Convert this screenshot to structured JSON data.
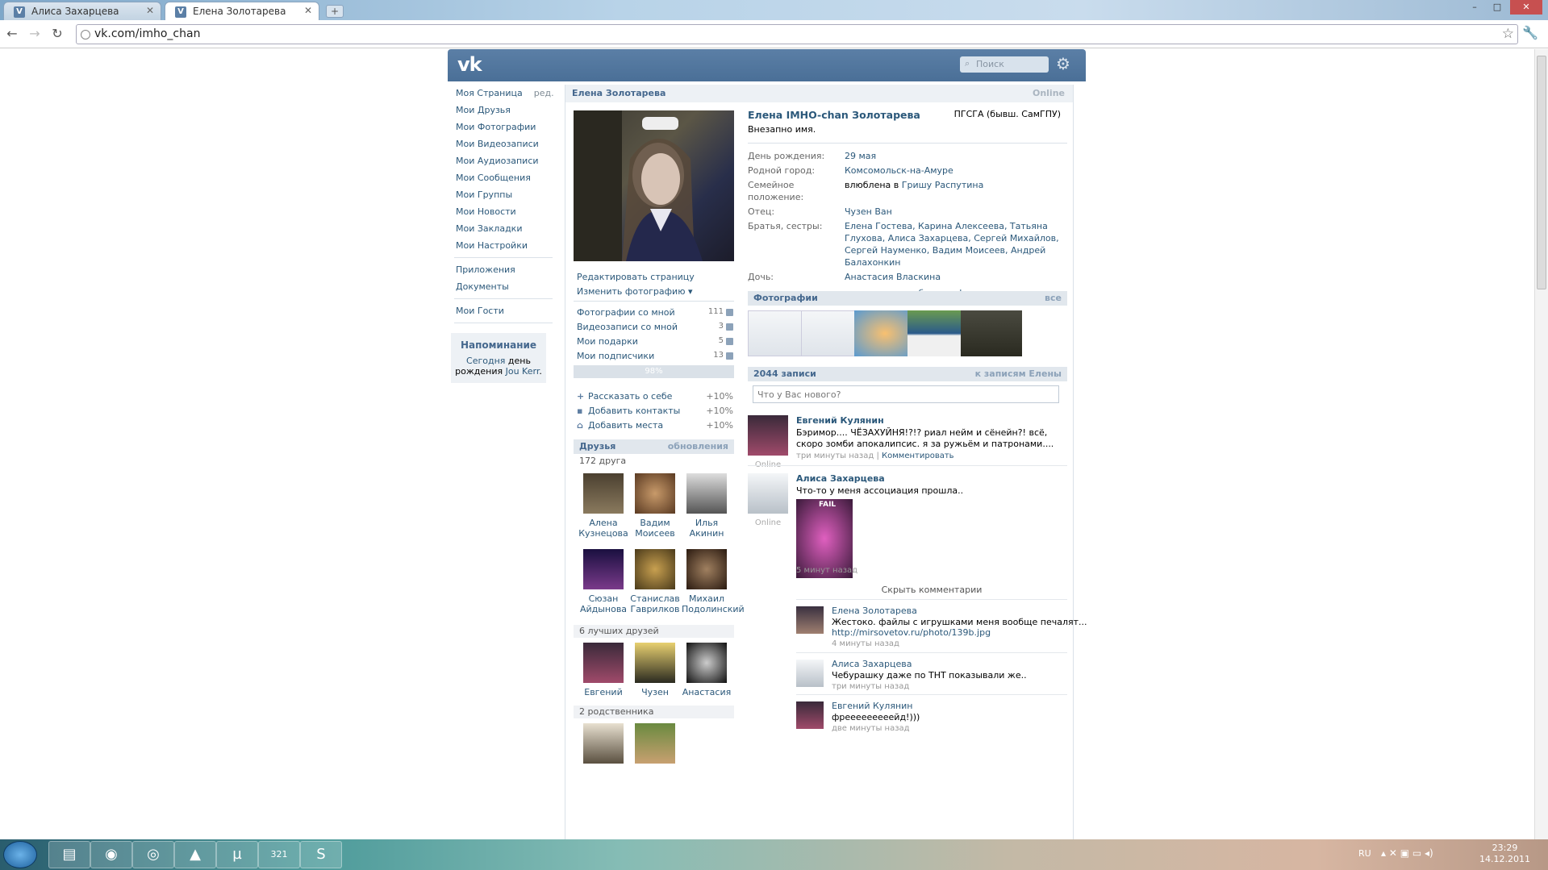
{
  "browser": {
    "tabs": [
      {
        "title": "Алиса Захарцева",
        "favicon": "V"
      },
      {
        "title": "Елена Золотарева",
        "favicon": "V"
      }
    ],
    "new_tab": "+",
    "url": "vk.com/imho_chan",
    "back": "←",
    "forward": "→",
    "reload": "↻",
    "star": "☆",
    "wrench": "🔧",
    "win_min": "–",
    "win_max": "□",
    "win_close": "✕"
  },
  "vk": {
    "logo": "vk",
    "search_placeholder": "Поиск",
    "gear": "⚙",
    "nav": {
      "my_page": "Моя Страница",
      "edit": "ред.",
      "friends": "Мои Друзья",
      "photos": "Мои Фотографии",
      "videos": "Мои Видеозаписи",
      "audio": "Мои Аудиозаписи",
      "messages": "Мои Сообщения",
      "groups": "Мои Группы",
      "news": "Мои Новости",
      "bookmarks": "Мои Закладки",
      "settings": "Мои Настройки",
      "apps": "Приложения",
      "docs": "Документы",
      "guests": "Мои Гости"
    },
    "reminder": {
      "title": "Напоминание",
      "line1": "Сегодня",
      "line1b": "день",
      "line2": "рождения",
      "name": "Jou Kerr",
      "dot": "."
    },
    "profile": {
      "header_name": "Елена Золотарева",
      "online": "Online",
      "full_name": "Елена IMHO-chan Золотарева",
      "status": "Внезапно имя.",
      "university": "ПГСГА (бывш. СамГПУ)",
      "edit_page": "Редактировать страницу",
      "change_photo": "Изменить фотографию",
      "change_photo_arrow": "▾",
      "info": {
        "birthday_label": "День рождения:",
        "birthday": "29 мая",
        "hometown_label": "Родной город:",
        "hometown": "Комсомольск-на-Амуре",
        "relationship_label": "Семейное положение:",
        "relationship_text": "влюблена в",
        "relationship_person": "Гришу Распутина",
        "father_label": "Отец:",
        "father": "Чузен Ван",
        "siblings_label": "Братья, сестры:",
        "siblings": "Елена Гостева, Карина Алексеева, Татьяна Глухова, Алиса Захарцева, Сергей Михайлов, Сергей Науменко, Вадим Моисеев, Андрей Балахонкин",
        "daughter_label": "Дочь:",
        "daughter": "Анастасия Власкина",
        "more": "показать подробную информацию"
      },
      "stats": [
        {
          "label": "Фотографии со мной",
          "count": "111"
        },
        {
          "label": "Видеозаписи со мной",
          "count": "3"
        },
        {
          "label": "Мои подарки",
          "count": "5"
        },
        {
          "label": "Мои подписчики",
          "count": "13"
        }
      ],
      "completion": "98%",
      "tasks": [
        {
          "plus": "+",
          "label": "Рассказать о себе",
          "pct": "+10%"
        },
        {
          "plus": "▪",
          "label": "Добавить контакты",
          "pct": "+10%"
        },
        {
          "plus": "⌂",
          "label": "Добавить места",
          "pct": "+10%"
        }
      ]
    },
    "friends": {
      "title": "Друзья",
      "updates": "обновления",
      "count": "172 друга",
      "list": [
        {
          "first": "Алена",
          "last": "Кузнецова"
        },
        {
          "first": "Вадим",
          "last": "Моисеев"
        },
        {
          "first": "Илья",
          "last": "Акинин"
        },
        {
          "first": "Сюзан",
          "last": "Айдынова"
        },
        {
          "first": "Станислав",
          "last": "Гаврилков"
        },
        {
          "first": "Михаил",
          "last": "Подолинский"
        }
      ],
      "best_title": "6 лучших друзей",
      "best": [
        {
          "first": "Евгений"
        },
        {
          "first": "Чузен"
        },
        {
          "first": "Анастасия"
        }
      ],
      "relatives_title": "2 родственника"
    },
    "photos": {
      "title": "Фотографии",
      "all": "все"
    },
    "wall": {
      "count": "2044 записи",
      "to_posts": "к записям Елены",
      "placeholder": "Что у Вас нового?",
      "posts": [
        {
          "author": "Евгений Кулянин",
          "text": "Бэримор.... ЧЁЗАХУЙНЯ!?!? риал нейм и сёнейн?! всё, скоро зомби апокалипсис. я за ружьём и патронами....",
          "online": "Online",
          "time": "три минуты назад",
          "separator": "|",
          "comment": "Комментировать"
        },
        {
          "author": "Алиса Захарцева",
          "text": "Что-то у меня ассоциация прошла..",
          "online": "Online",
          "image_caption": "FAIL",
          "time": "5 минут назад"
        }
      ],
      "hide_comments": "Скрыть комментарии",
      "comments": [
        {
          "author": "Елена Золотарева",
          "text": "Жестоко. файлы с игрушками меня вообще печалят...",
          "link": "http://mirsovetov.ru/photo/139b.jpg",
          "time": "4 минуты назад"
        },
        {
          "author": "Алиса Захарцева",
          "text": "Чебурашку даже по ТНТ показывали же..",
          "time": "три минуты назад"
        },
        {
          "author": "Евгений Кулянин",
          "text": "фрееееееееейд!)))",
          "time": "две минуты назад"
        }
      ]
    }
  },
  "taskbar": {
    "lang": "RU",
    "time": "23:29",
    "date": "14.12.2011",
    "calendar_badge": "321"
  }
}
